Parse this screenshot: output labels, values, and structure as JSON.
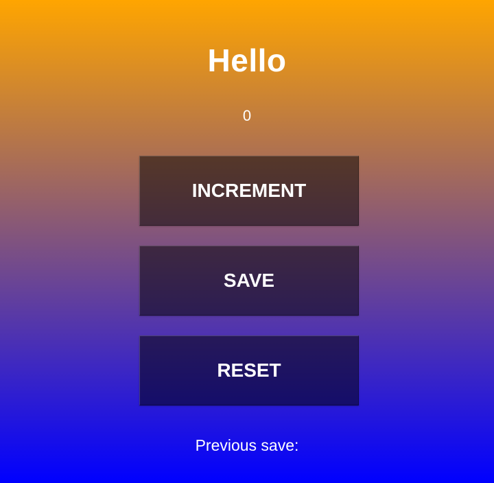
{
  "header": {
    "title": "Hello"
  },
  "counter": {
    "value": "0"
  },
  "buttons": {
    "increment_label": "INCREMENT",
    "save_label": "SAVE",
    "reset_label": "RESET"
  },
  "footer": {
    "previous_save_label": "Previous save:"
  },
  "colors": {
    "gradient_top": "#ffa500",
    "gradient_bottom": "#0000ff",
    "button_overlay": "rgba(0,0,0,0.5)",
    "text": "#ffffff"
  }
}
